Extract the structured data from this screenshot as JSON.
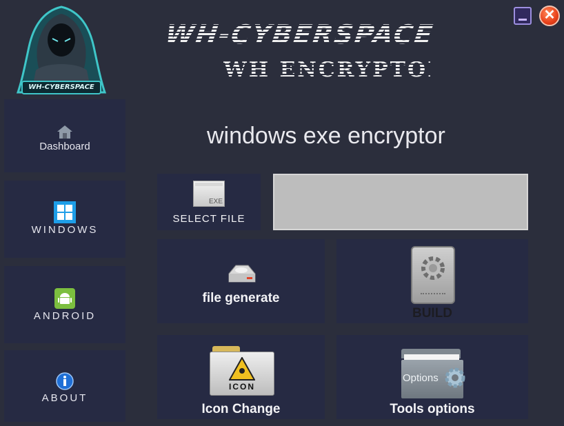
{
  "header": {
    "brand_title": "WH-CYBERSPACE",
    "app_title": "WH ENCRYPTOR",
    "logo_text": "WH-CYBERSPACE"
  },
  "window_controls": {
    "minimize_icon": "minimize-icon",
    "close_icon": "close-icon"
  },
  "sidebar": {
    "items": [
      {
        "label": "Dashboard",
        "icon": "home-icon"
      },
      {
        "label": "WINDOWS",
        "icon": "windows-icon"
      },
      {
        "label": "ANDROID",
        "icon": "android-icon"
      },
      {
        "label": "ABOUT",
        "icon": "info-icon"
      }
    ]
  },
  "main": {
    "heading": "windows exe encryptor",
    "select_file": {
      "label": "SELECT FILE",
      "icon_text": "EXE"
    },
    "file_path": {
      "value": ""
    },
    "file_generate": {
      "label": "file generate"
    },
    "build": {
      "label": "BUILD"
    },
    "icon_change": {
      "label": "Icon Change",
      "icon_text": "ICON"
    },
    "tools_options": {
      "label": "Tools options",
      "icon_text": "Options"
    }
  },
  "colors": {
    "background": "#2b2e3c",
    "panel": "#262a43",
    "text": "#e6e6ee",
    "accent_teal": "#3fc6c8"
  }
}
